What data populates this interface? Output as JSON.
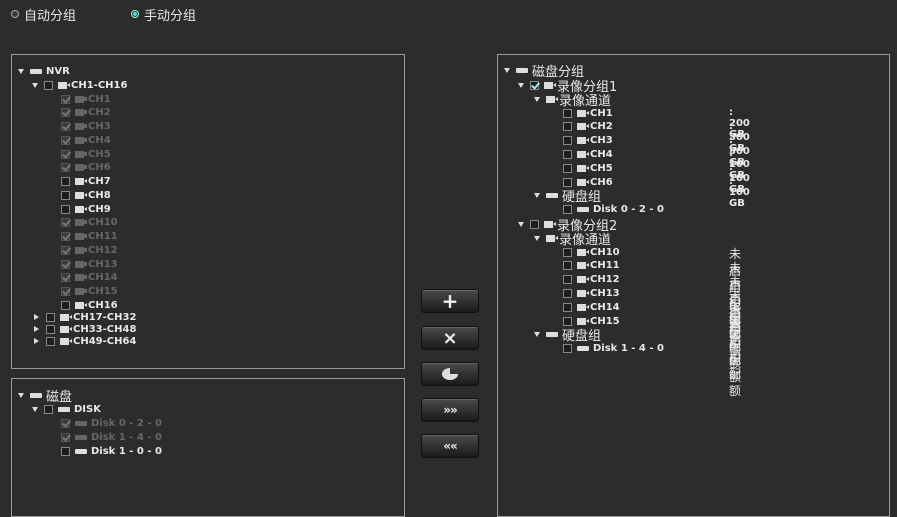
{
  "radios": [
    {
      "label": "自动分组",
      "selected": false
    },
    {
      "label": "手动分组",
      "selected": true
    }
  ],
  "channel_tree": {
    "root": "NVR",
    "group": "CH1-CH16",
    "channels": [
      {
        "label": "CH1",
        "enabled": false
      },
      {
        "label": "CH2",
        "enabled": false
      },
      {
        "label": "CH3",
        "enabled": false
      },
      {
        "label": "CH4",
        "enabled": false
      },
      {
        "label": "CH5",
        "enabled": false
      },
      {
        "label": "CH6",
        "enabled": false
      },
      {
        "label": "CH7",
        "enabled": true
      },
      {
        "label": "CH8",
        "enabled": true
      },
      {
        "label": "CH9",
        "enabled": true
      },
      {
        "label": "CH10",
        "enabled": false
      },
      {
        "label": "CH11",
        "enabled": false
      },
      {
        "label": "CH12",
        "enabled": false
      },
      {
        "label": "CH13",
        "enabled": false
      },
      {
        "label": "CH14",
        "enabled": false
      },
      {
        "label": "CH15",
        "enabled": false
      },
      {
        "label": "CH16",
        "enabled": true
      }
    ],
    "collapsed_groups": [
      "CH17-CH32",
      "CH33-CH48",
      "CH49-CH64"
    ]
  },
  "disk_tree": {
    "root": "磁盘",
    "group": "DISK",
    "disks": [
      {
        "label": "Disk 0 - 2 - 0",
        "enabled": false
      },
      {
        "label": "Disk 1 - 4 - 0",
        "enabled": false
      },
      {
        "label": "Disk 1 - 0 - 0",
        "enabled": true
      }
    ]
  },
  "buttons": {
    "add": "+",
    "remove": "×",
    "quota_icon": "pie-chart-icon",
    "move_right": "»»",
    "move_left": "««"
  },
  "group_tree": {
    "root": "磁盘分组",
    "groups": [
      {
        "label": "录像分组1",
        "checked": true,
        "channels_label": "录像通道",
        "channels": [
          {
            "label": "CH1",
            "quota": ": 200 GB"
          },
          {
            "label": "CH2",
            "quota": ": 300 GB"
          },
          {
            "label": "CH3",
            "quota": ": 300 GB"
          },
          {
            "label": "CH4",
            "quota": ": 100 GB"
          },
          {
            "label": "CH5",
            "quota": ": 100 GB"
          },
          {
            "label": "CH6",
            "quota": ": 100 GB"
          }
        ],
        "disks_label": "硬盘组",
        "disks": [
          "Disk 0 - 2 - 0"
        ]
      },
      {
        "label": "录像分组2",
        "checked": false,
        "channels_label": "录像通道",
        "channels": [
          {
            "label": "CH10",
            "quota": "未启用配额"
          },
          {
            "label": "CH11",
            "quota": "未启用配额"
          },
          {
            "label": "CH12",
            "quota": "未启用配额"
          },
          {
            "label": "CH13",
            "quota": "未启用配额"
          },
          {
            "label": "CH14",
            "quota": "未启用配额"
          },
          {
            "label": "CH15",
            "quota": "未启用配额"
          }
        ],
        "disks_label": "硬盘组",
        "disks": [
          "Disk 1 - 4 - 0"
        ]
      }
    ]
  }
}
